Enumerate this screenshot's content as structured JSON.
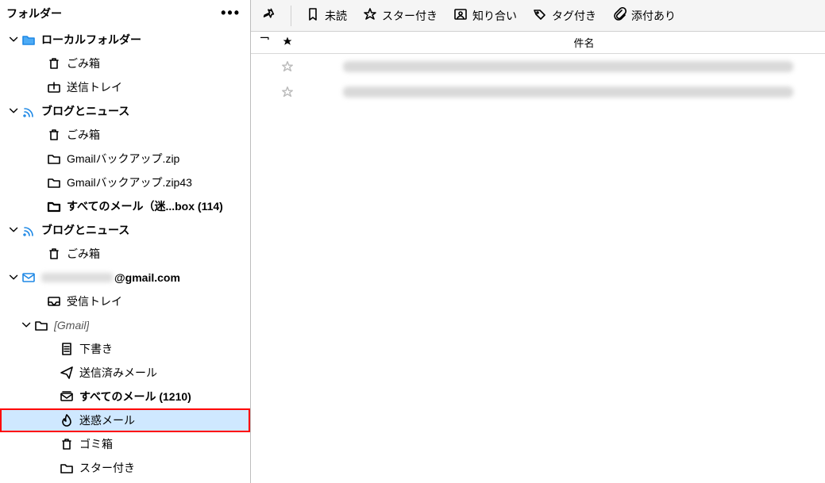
{
  "sidebar": {
    "title": "フォルダー",
    "tree": [
      {
        "chevron": "down",
        "indent": 10,
        "icon": "folder-blue",
        "label": "ローカルフォルダー",
        "bold": true
      },
      {
        "chevron": "none",
        "indent": 42,
        "icon": "trash",
        "label": "ごみ箱"
      },
      {
        "chevron": "none",
        "indent": 42,
        "icon": "outbox",
        "label": "送信トレイ"
      },
      {
        "chevron": "down",
        "indent": 10,
        "icon": "rss",
        "label": "ブログとニュース",
        "bold": true
      },
      {
        "chevron": "none",
        "indent": 42,
        "icon": "trash",
        "label": "ごみ箱"
      },
      {
        "chevron": "none",
        "indent": 42,
        "icon": "folder",
        "label": "Gmailバックアップ.zip"
      },
      {
        "chevron": "none",
        "indent": 42,
        "icon": "folder",
        "label": "Gmailバックアップ.zip43"
      },
      {
        "chevron": "none",
        "indent": 42,
        "icon": "folder-bold",
        "label": "すべてのメール（迷...box (114)",
        "bold": true
      },
      {
        "chevron": "down",
        "indent": 10,
        "icon": "rss",
        "label": "ブログとニュース",
        "bold": true
      },
      {
        "chevron": "none",
        "indent": 42,
        "icon": "trash",
        "label": "ごみ箱"
      },
      {
        "chevron": "down",
        "indent": 10,
        "icon": "mail-blue",
        "label": "@gmail.com",
        "bold": true,
        "blurprefix": true
      },
      {
        "chevron": "none",
        "indent": 42,
        "icon": "inbox",
        "label": "受信トレイ"
      },
      {
        "chevron": "down",
        "indent": 26,
        "icon": "folder",
        "label": "[Gmail]",
        "italic": true
      },
      {
        "chevron": "none",
        "indent": 58,
        "icon": "draft",
        "label": "下書き"
      },
      {
        "chevron": "none",
        "indent": 58,
        "icon": "sent",
        "label": "送信済みメール"
      },
      {
        "chevron": "none",
        "indent": 58,
        "icon": "allmail",
        "label": "すべてのメール (1210)",
        "bold": true
      },
      {
        "chevron": "none",
        "indent": 58,
        "icon": "fire",
        "label": "迷惑メール",
        "selected": true,
        "redbox": true
      },
      {
        "chevron": "none",
        "indent": 58,
        "icon": "trash",
        "label": "ゴミ箱"
      },
      {
        "chevron": "none",
        "indent": 58,
        "icon": "folder",
        "label": "スター付き"
      }
    ]
  },
  "toolbar": {
    "filters": [
      {
        "icon": "bookmark",
        "label": "未読"
      },
      {
        "icon": "star",
        "label": "スター付き"
      },
      {
        "icon": "contact",
        "label": "知り合い"
      },
      {
        "icon": "tag",
        "label": "タグ付き"
      },
      {
        "icon": "clip",
        "label": "添付あり"
      }
    ]
  },
  "list_header": {
    "subject": "件名"
  },
  "messages": [
    {
      "starred": false
    },
    {
      "starred": false
    }
  ]
}
